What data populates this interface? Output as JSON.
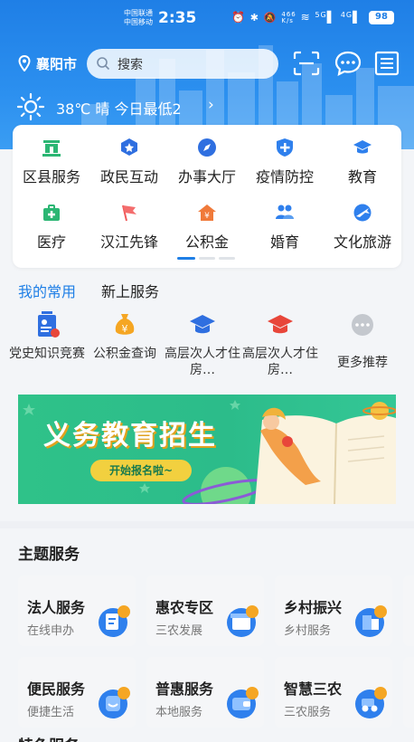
{
  "status_bar": {
    "carrier_1": "中国联通",
    "carrier_2": "中国移动",
    "time": "2:35",
    "net_speed": "466",
    "net_unit": "K/s",
    "signal_1": "5G",
    "signal_2": "4G",
    "battery": "98"
  },
  "header": {
    "city": "襄阳市",
    "search_placeholder": "搜索",
    "weather_text": "38℃   晴   今日最低2",
    "weather_chevron": "›"
  },
  "services": [
    {
      "label": "区县服务",
      "icon": "government-building-icon",
      "color": "#2bb673"
    },
    {
      "label": "政民互动",
      "icon": "chat-star-icon",
      "color": "#2f6fe0"
    },
    {
      "label": "办事大厅",
      "icon": "compass-icon",
      "color": "#2f6fe0"
    },
    {
      "label": "疫情防控",
      "icon": "shield-plus-icon",
      "color": "#2f80ed"
    },
    {
      "label": "教育",
      "icon": "graduation-cap-icon",
      "color": "#2f80ed"
    },
    {
      "label": "医疗",
      "icon": "medical-kit-icon",
      "color": "#2bb673"
    },
    {
      "label": "汉江先锋",
      "icon": "flag-icon",
      "color": "#f05a5a"
    },
    {
      "label": "公积金",
      "icon": "house-yuan-icon",
      "color": "#f07a3a"
    },
    {
      "label": "婚育",
      "icon": "family-icon",
      "color": "#2f80ed"
    },
    {
      "label": "文化旅游",
      "icon": "plane-globe-icon",
      "color": "#2f80ed"
    }
  ],
  "common": {
    "tabs": [
      "我的常用",
      "新上服务"
    ],
    "items": [
      {
        "label": "党史知识竞赛",
        "icon": "party-history-icon"
      },
      {
        "label": "公积金查询",
        "icon": "money-bag-icon"
      },
      {
        "label": "高层次人才住房…",
        "icon": "graduation-cap-icon"
      },
      {
        "label": "高层次人才住房…",
        "icon": "graduation-cap-icon"
      },
      {
        "label": "更多推荐",
        "icon": "more-icon"
      }
    ]
  },
  "banner": {
    "title": "义务教育招生",
    "button": "开始报名啦~"
  },
  "theme": {
    "title": "主题服务",
    "cards": [
      {
        "title": "法人服务",
        "sub": "在线申办",
        "icon": "document-badge-icon"
      },
      {
        "title": "惠农专区",
        "sub": "三农发展",
        "icon": "shop-icon"
      },
      {
        "title": "乡村振兴",
        "sub": "乡村服务",
        "icon": "village-icon"
      },
      {
        "title": "便民服务",
        "sub": "便捷生活",
        "icon": "smile-icon"
      },
      {
        "title": "普惠服务",
        "sub": "本地服务",
        "icon": "wallet-icon"
      },
      {
        "title": "智慧三农",
        "sub": "三农服务",
        "icon": "tractor-icon"
      }
    ],
    "next_title": "特色服务"
  },
  "colors": {
    "primary": "#1f7fe6",
    "banner_green": "#2fc289",
    "banner_button": "#f2d03f"
  }
}
